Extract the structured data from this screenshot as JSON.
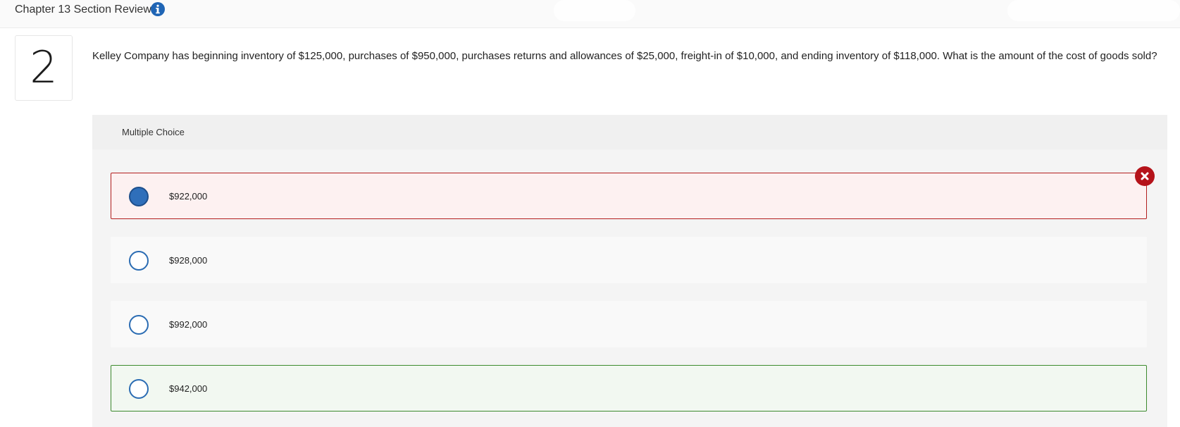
{
  "header": {
    "title": "Chapter 13 Section Review"
  },
  "question": {
    "number": "2",
    "text": "Kelley Company has beginning inventory of $125,000, purchases of $950,000, purchases returns and allowances of $25,000, freight-in of $10,000, and ending inventory of $118,000. What is the amount of the cost of goods sold?"
  },
  "answer_area": {
    "type_label": "Multiple Choice",
    "options": [
      {
        "label": "$922,000",
        "selected": true,
        "state": "incorrect"
      },
      {
        "label": "$928,000",
        "selected": false,
        "state": "neutral"
      },
      {
        "label": "$992,000",
        "selected": false,
        "state": "neutral"
      },
      {
        "label": "$942,000",
        "selected": false,
        "state": "correct"
      }
    ]
  },
  "icons": {
    "info": "info-icon",
    "incorrect": "close-icon"
  },
  "colors": {
    "accent_blue": "#1f65b5",
    "incorrect_red": "#b31e1e",
    "correct_green": "#3c8a2e"
  }
}
